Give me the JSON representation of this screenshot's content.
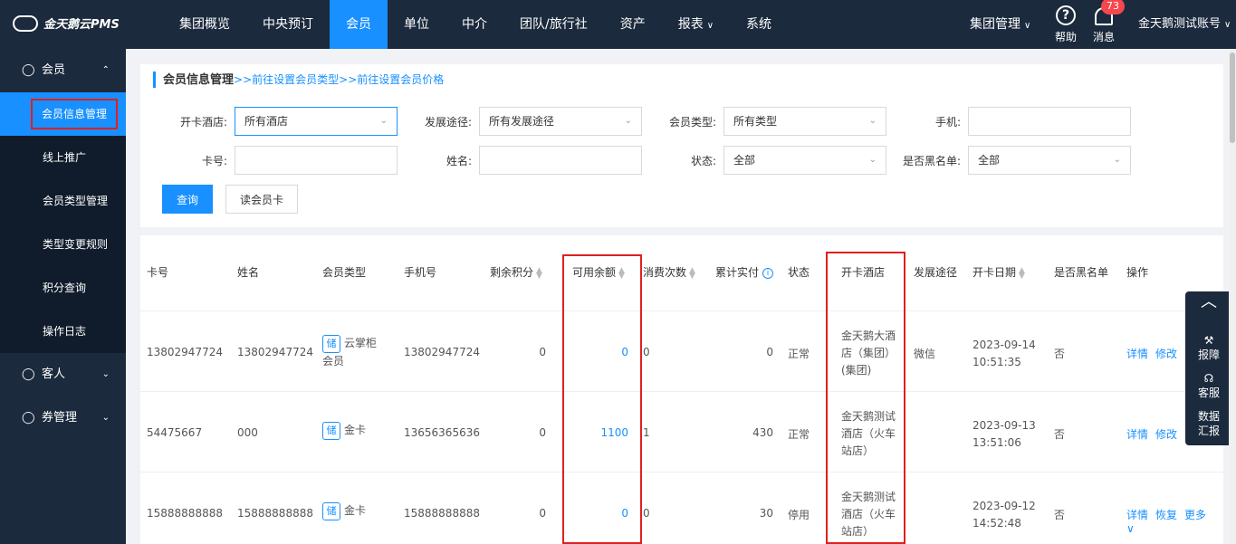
{
  "app": {
    "logo_text": "金天鹅云PMS"
  },
  "nav": {
    "items": [
      {
        "label": "集团概览"
      },
      {
        "label": "中央预订"
      },
      {
        "label": "会员"
      },
      {
        "label": "单位"
      },
      {
        "label": "中介"
      },
      {
        "label": "团队/旅行社"
      },
      {
        "label": "资产"
      },
      {
        "label": "报表"
      },
      {
        "label": "系统"
      }
    ],
    "caret": "∨",
    "group_mgmt": "集团管理",
    "help": "帮助",
    "help_glyph": "?",
    "messages": "消息",
    "message_count": "73",
    "account": "金天鹅测试账号"
  },
  "sidebar": {
    "member_group": "会员",
    "items": [
      {
        "label": "会员信息管理"
      },
      {
        "label": "线上推广"
      },
      {
        "label": "会员类型管理"
      },
      {
        "label": "类型变更规则"
      },
      {
        "label": "积分查询"
      },
      {
        "label": "操作日志"
      }
    ],
    "guest_group": "客人",
    "coupon_group": "券管理",
    "caret_up": "⌃",
    "caret_down": "⌄"
  },
  "breadcrumb": {
    "title": "会员信息管理",
    "link1": ">>前往设置会员类型",
    "link2": ">>前往设置会员价格"
  },
  "filters": {
    "hotel_label": "开卡酒店:",
    "hotel_value": "所有酒店",
    "channel_label": "发展途径:",
    "channel_value": "所有发展途径",
    "type_label": "会员类型:",
    "type_value": "所有类型",
    "phone_label": "手机:",
    "card_label": "卡号:",
    "name_label": "姓名:",
    "status_label": "状态:",
    "status_value": "全部",
    "blacklist_label": "是否黑名单:",
    "blacklist_value": "全部",
    "query_button": "查询",
    "read_card_button": "读会员卡"
  },
  "table": {
    "headers": {
      "card": "卡号",
      "name": "姓名",
      "type": "会员类型",
      "phone": "手机号",
      "points": "剩余积分",
      "balance": "可用余额",
      "visits": "消费次数",
      "paid": "累计实付",
      "status": "状态",
      "hotel": "开卡酒店",
      "channel": "发展途径",
      "date": "开卡日期",
      "blacklist": "是否黑名单",
      "actions": "操作"
    },
    "rows": [
      {
        "card": "13802947724",
        "name": "13802947724",
        "badge": "储",
        "type_line1": "云掌柜",
        "type_line2": "会员",
        "phone": "13802947724",
        "points": "0",
        "balance": "0",
        "visits": "0",
        "paid": "0",
        "status": "正常",
        "hotel_l1": "金天鹅大酒",
        "hotel_l2": "店（集团）",
        "hotel_l3": "(集团)",
        "channel": "微信",
        "date": "2023-09-14",
        "time": "10:51:35",
        "blacklist": "否",
        "action1": "详情",
        "action2": "修改"
      },
      {
        "card": "54475667",
        "name": "000",
        "badge": "储",
        "type_line1": "金卡",
        "type_line2": "",
        "phone": "13656365636",
        "points": "0",
        "balance": "1100",
        "visits": "1",
        "paid": "430",
        "status": "正常",
        "hotel_l1": "金天鹅测试",
        "hotel_l2": "酒店（火车",
        "hotel_l3": "站店）",
        "channel": "",
        "date": "2023-09-13",
        "time": "13:51:06",
        "blacklist": "否",
        "action1": "详情",
        "action2": "修改"
      },
      {
        "card": "15888888888",
        "name": "15888888888",
        "badge": "储",
        "type_line1": "金卡",
        "type_line2": "",
        "phone": "15888888888",
        "points": "0",
        "balance": "0",
        "visits": "0",
        "paid": "30",
        "status": "停用",
        "hotel_l1": "金天鹅测试",
        "hotel_l2": "酒店（火车",
        "hotel_l3": "站店）",
        "channel": "",
        "date": "2023-09-12",
        "time": "14:52:48",
        "blacklist": "否",
        "action1": "详情",
        "action2": "恢复",
        "action3": "更多 ∨"
      }
    ]
  },
  "float_tool": {
    "up": "︿",
    "report": "报障",
    "service": "客服",
    "data_line1": "数据",
    "data_line2": "汇报"
  },
  "colors": {
    "nav_bg": "#1b2a3d",
    "accent": "#1890ff",
    "highlight": "#e02020"
  },
  "icons": [
    "logo-icon",
    "help-icon",
    "bell-icon",
    "user-icon",
    "wrench-icon",
    "headset-icon",
    "sort-icon",
    "info-icon"
  ]
}
